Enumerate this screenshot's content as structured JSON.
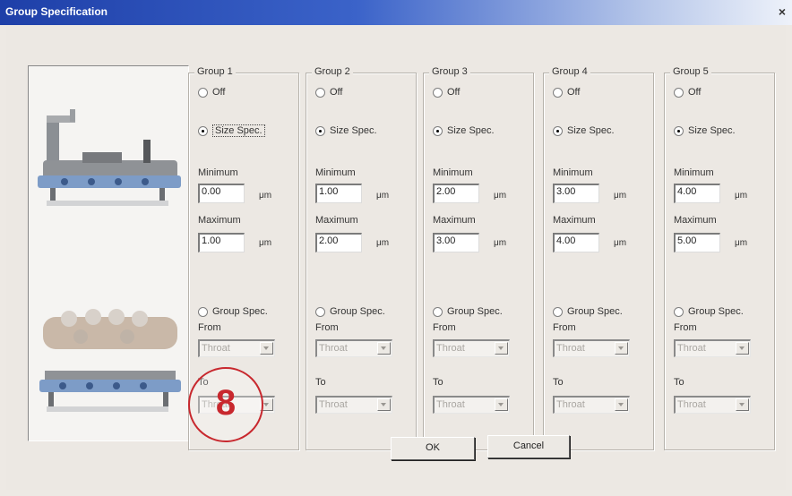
{
  "window": {
    "title": "Group Specification",
    "close_label": "×"
  },
  "groups": [
    {
      "name": "Group 1",
      "off": "Off",
      "size_spec": "Size Spec.",
      "minimum_label": "Minimum",
      "minimum": "0.00",
      "maximum_label": "Maximum",
      "maximum": "1.00",
      "unit": "μm",
      "group_spec": "Group Spec.",
      "from_label": "From",
      "from": "Throat",
      "to_label": "To",
      "to": "Throat"
    },
    {
      "name": "Group 2",
      "off": "Off",
      "size_spec": "Size Spec.",
      "minimum_label": "Minimum",
      "minimum": "1.00",
      "maximum_label": "Maximum",
      "maximum": "2.00",
      "unit": "μm",
      "group_spec": "Group Spec.",
      "from_label": "From",
      "from": "Throat",
      "to_label": "To",
      "to": "Throat"
    },
    {
      "name": "Group 3",
      "off": "Off",
      "size_spec": "Size Spec.",
      "minimum_label": "Minimum",
      "minimum": "2.00",
      "maximum_label": "Maximum",
      "maximum": "3.00",
      "unit": "μm",
      "group_spec": "Group Spec.",
      "from_label": "From",
      "from": "Throat",
      "to_label": "To",
      "to": "Throat"
    },
    {
      "name": "Group 4",
      "off": "Off",
      "size_spec": "Size Spec.",
      "minimum_label": "Minimum",
      "minimum": "3.00",
      "maximum_label": "Maximum",
      "maximum": "4.00",
      "unit": "μm",
      "group_spec": "Group Spec.",
      "from_label": "From",
      "from": "Throat",
      "to_label": "To",
      "to": "Throat"
    },
    {
      "name": "Group 5",
      "off": "Off",
      "size_spec": "Size Spec.",
      "minimum_label": "Minimum",
      "minimum": "4.00",
      "maximum_label": "Maximum",
      "maximum": "5.00",
      "unit": "μm",
      "group_spec": "Group Spec.",
      "from_label": "From",
      "from": "Throat",
      "to_label": "To",
      "to": "Throat"
    }
  ],
  "selected_mode": "size_spec",
  "buttons": {
    "ok": "OK",
    "cancel": "Cancel"
  },
  "callout": {
    "number": "8",
    "color": "#c8282e"
  },
  "colors": {
    "titlebar_start": "#1e3fa8",
    "dialog_bg": "#ece8e3"
  },
  "icons": {
    "close": "close-icon",
    "dropdown": "chevron-down-icon"
  }
}
